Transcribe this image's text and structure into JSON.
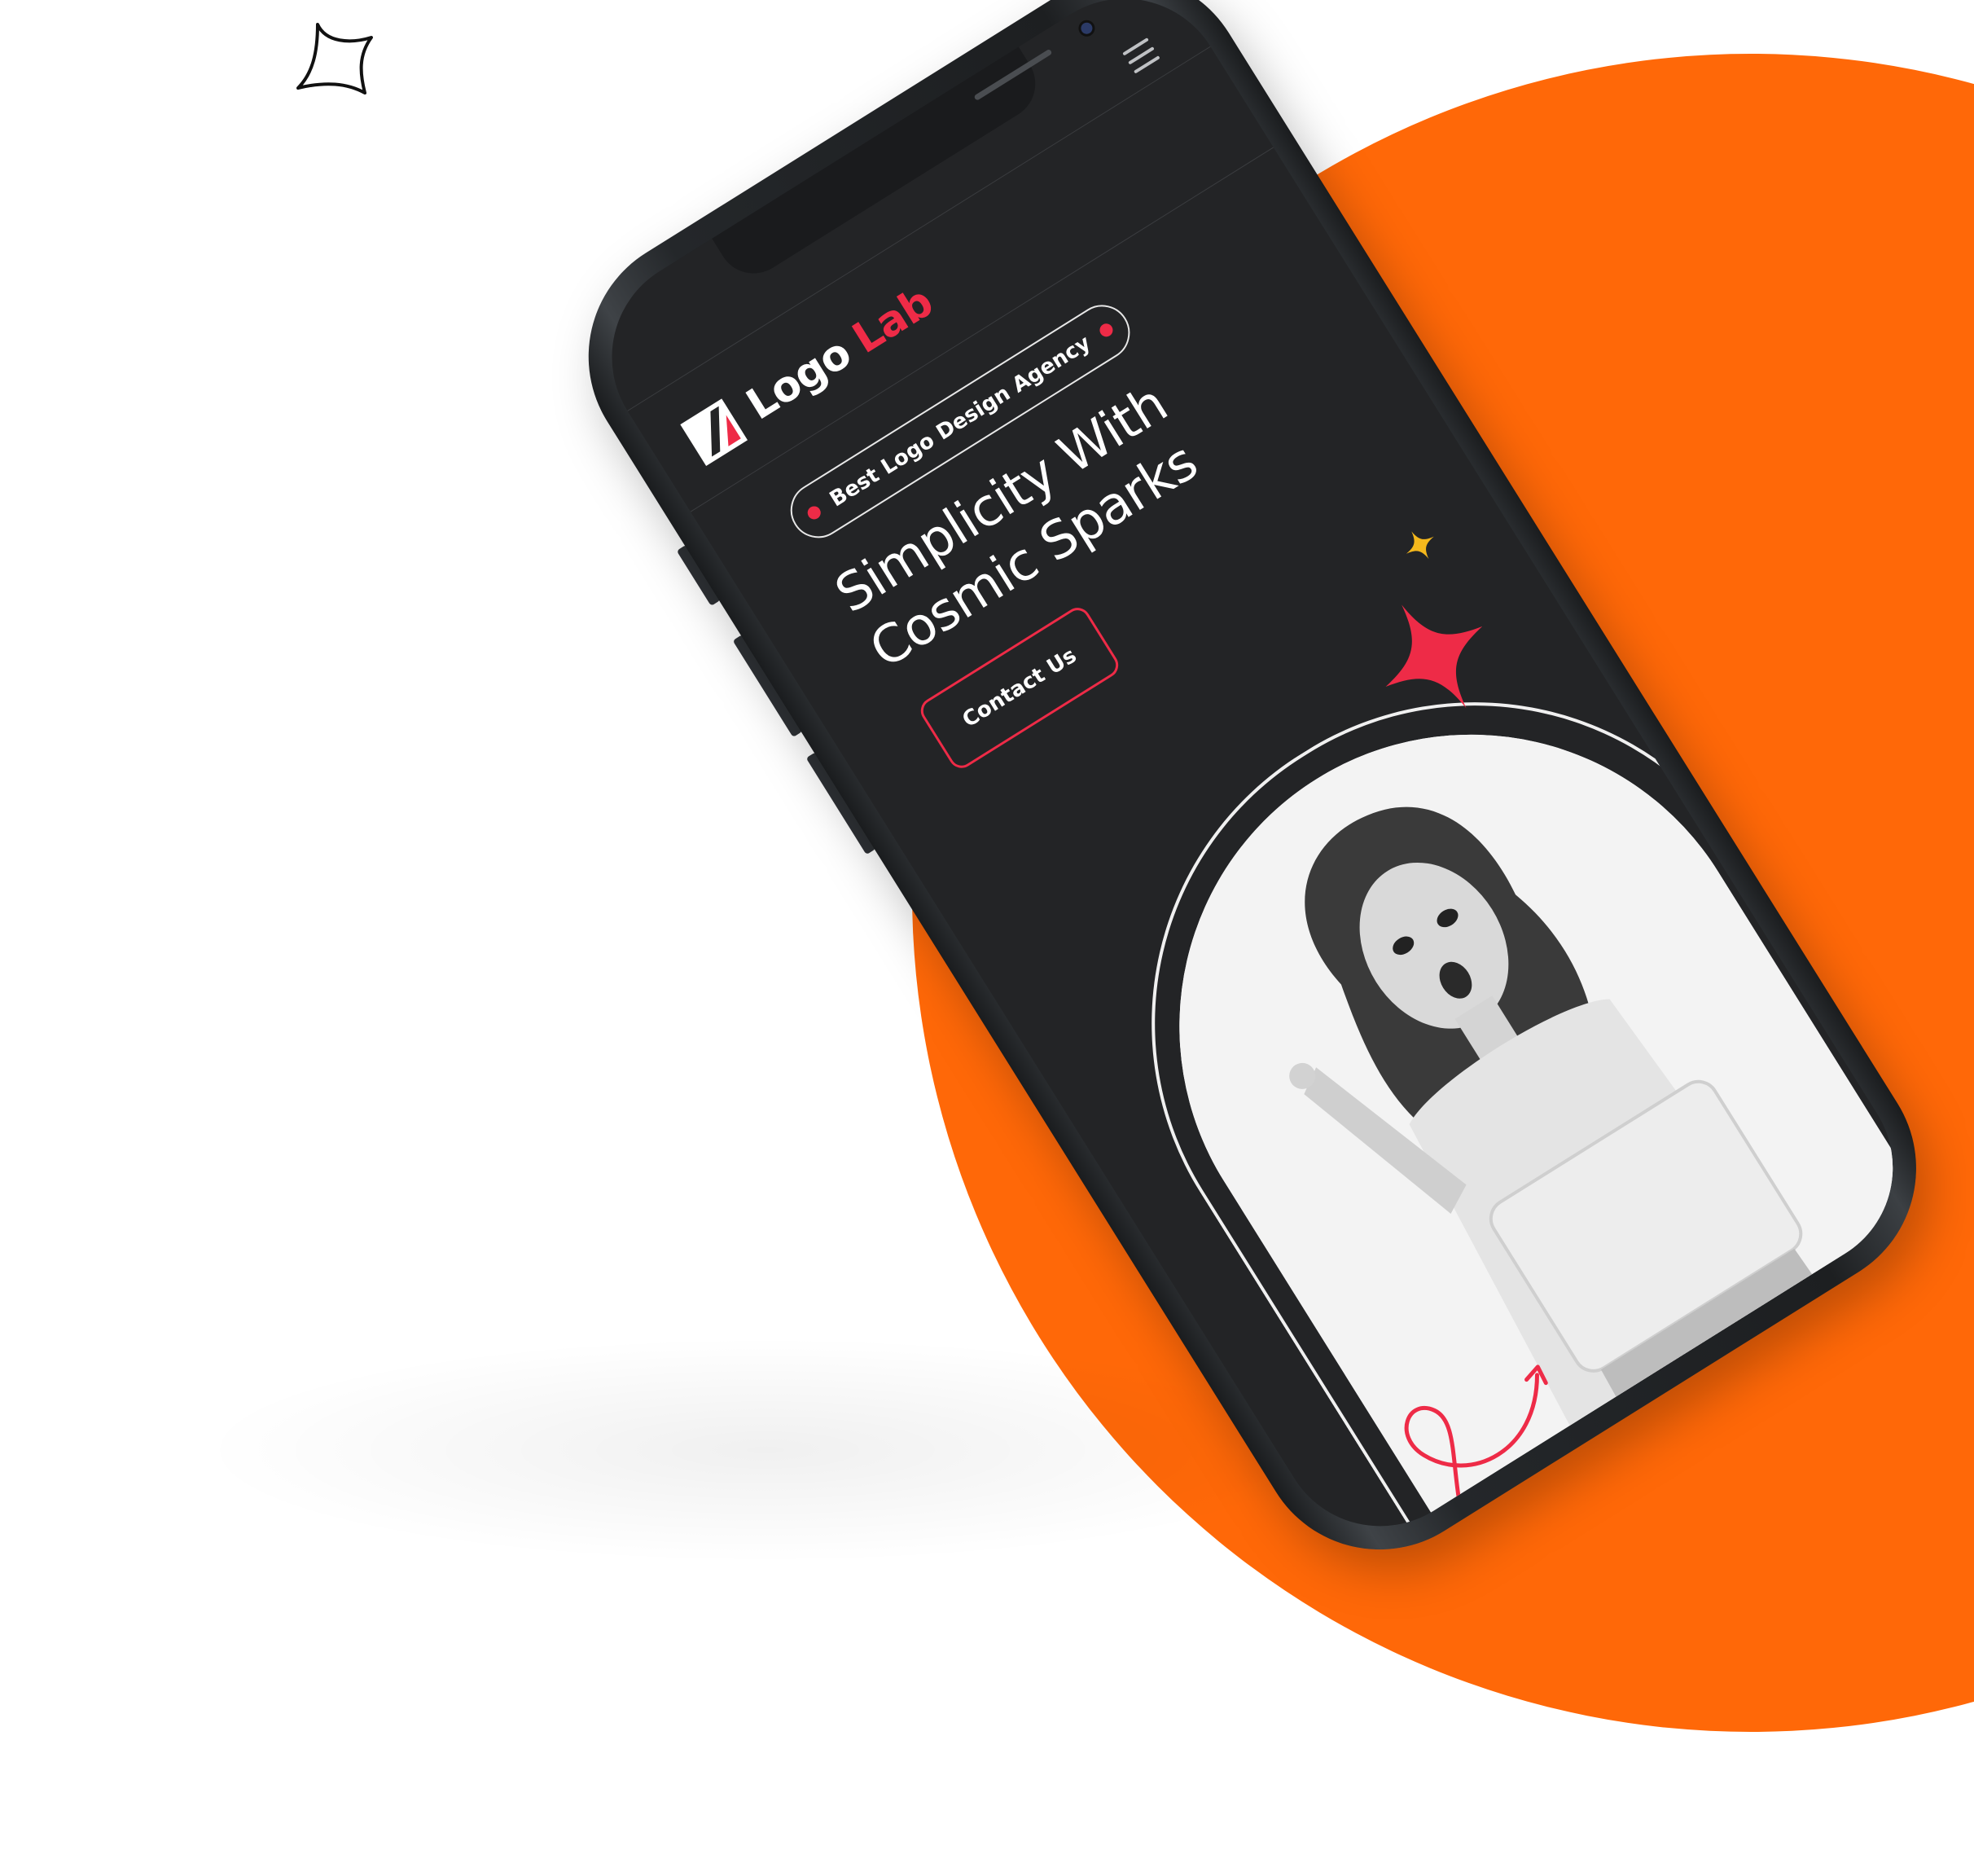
{
  "colors": {
    "orange": "#ff6808",
    "accent_red": "#ee2b47",
    "star_yellow": "#f5b81c",
    "screen_bg": "#232426"
  },
  "header": {
    "menu_icon": "hamburger-menu-icon"
  },
  "logo": {
    "icon": "logo-mark-icon",
    "word1": "Logo",
    "word2": "Lab"
  },
  "hero": {
    "badge": "Best Logo Design Agency",
    "headline": "Simplicity With Cosmic Sparks",
    "cta": "Contact Us"
  },
  "decor": {
    "sparkle_outline": "sparkle-outline-icon",
    "star_red": "four-point-star-icon",
    "star_yellow": "small-star-icon",
    "swirl": "swirl-arrow-icon"
  }
}
